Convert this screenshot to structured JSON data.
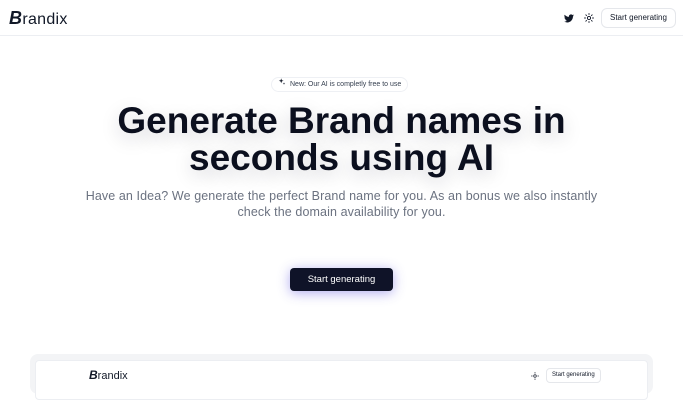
{
  "header": {
    "logo_initial": "B",
    "logo_rest": "randix",
    "twitter_icon": "twitter-icon",
    "theme_icon": "sun-icon",
    "cta_label": "Start generating"
  },
  "hero": {
    "pill_icon": "sparkle-icon",
    "pill_text": "New: Our AI is completly free to use",
    "headline_line1": "Generate Brand names in",
    "headline_line2": "seconds using AI",
    "subtext": "Have an Idea? We generate the perfect Brand name for you. As an bonus we also instantly check the domain availability for you.",
    "cta_label": "Start generating"
  },
  "preview": {
    "logo_initial": "B",
    "logo_rest": "randix",
    "theme_icon": "sun-icon",
    "cta_label": "Start generating"
  },
  "colors": {
    "primary": "#0f1328",
    "text": "#0b0f1e",
    "muted": "#6b7280",
    "glow": "#5046dc"
  }
}
